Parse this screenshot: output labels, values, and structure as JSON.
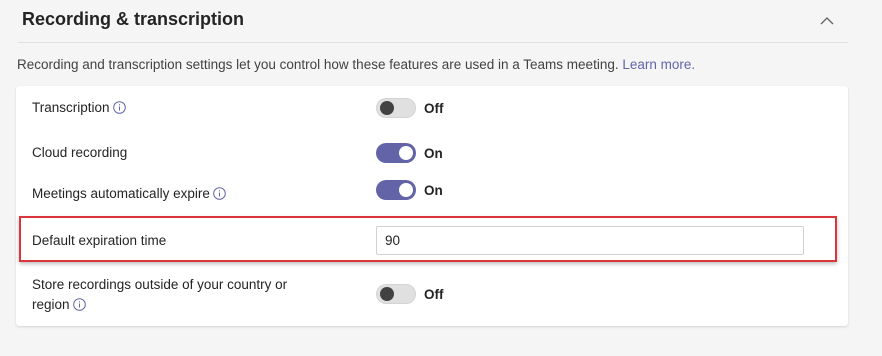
{
  "section": {
    "title": "Recording & transcription"
  },
  "intro": {
    "text": "Recording and transcription settings let you control how these features are used in a Teams meeting.",
    "link": "Learn more."
  },
  "settings": {
    "transcription": {
      "label": "Transcription",
      "state": "Off"
    },
    "cloud_recording": {
      "label": "Cloud recording",
      "state": "On"
    },
    "auto_expire": {
      "label": "Meetings automatically expire",
      "state": "On"
    },
    "default_expiration": {
      "label": "Default expiration time",
      "value": "90"
    },
    "store_outside": {
      "label_line1": "Store recordings outside of your country or",
      "label_line2": "region",
      "state": "Off"
    }
  },
  "colors": {
    "accent": "#6264a7",
    "highlight": "#d9363b"
  }
}
